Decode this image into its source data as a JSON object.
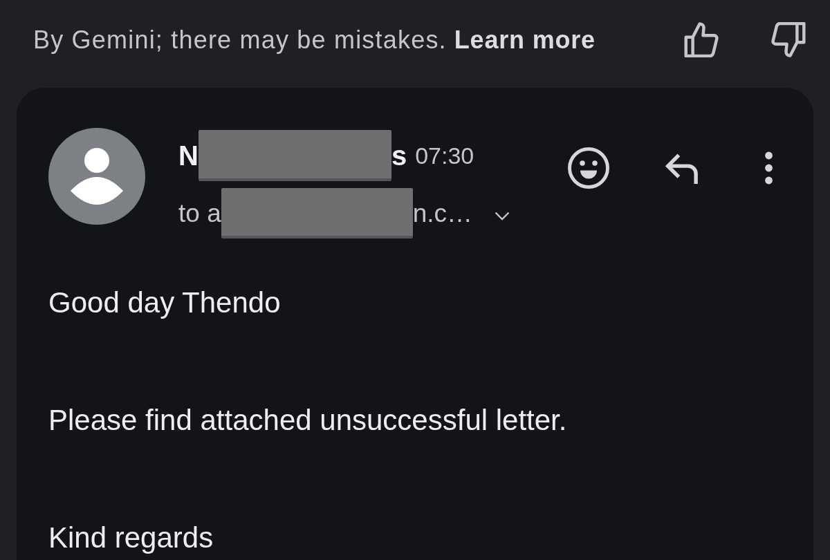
{
  "disclaimer": {
    "text": "By Gemini; there may be mistakes.",
    "link": "Learn more"
  },
  "message": {
    "sender": {
      "name": [
        {
          "kind": "text",
          "text": "N"
        },
        {
          "kind": "redacted"
        },
        {
          "kind": "text",
          "text": "s"
        }
      ],
      "time": "07:30"
    },
    "recipient": [
      {
        "kind": "text",
        "text": "to a"
      },
      {
        "kind": "redacted"
      },
      {
        "kind": "text",
        "text": "n.c…"
      }
    ],
    "body": [
      "Good day Thendo",
      "Please find attached unsuccessful letter.",
      "Kind regards"
    ]
  }
}
